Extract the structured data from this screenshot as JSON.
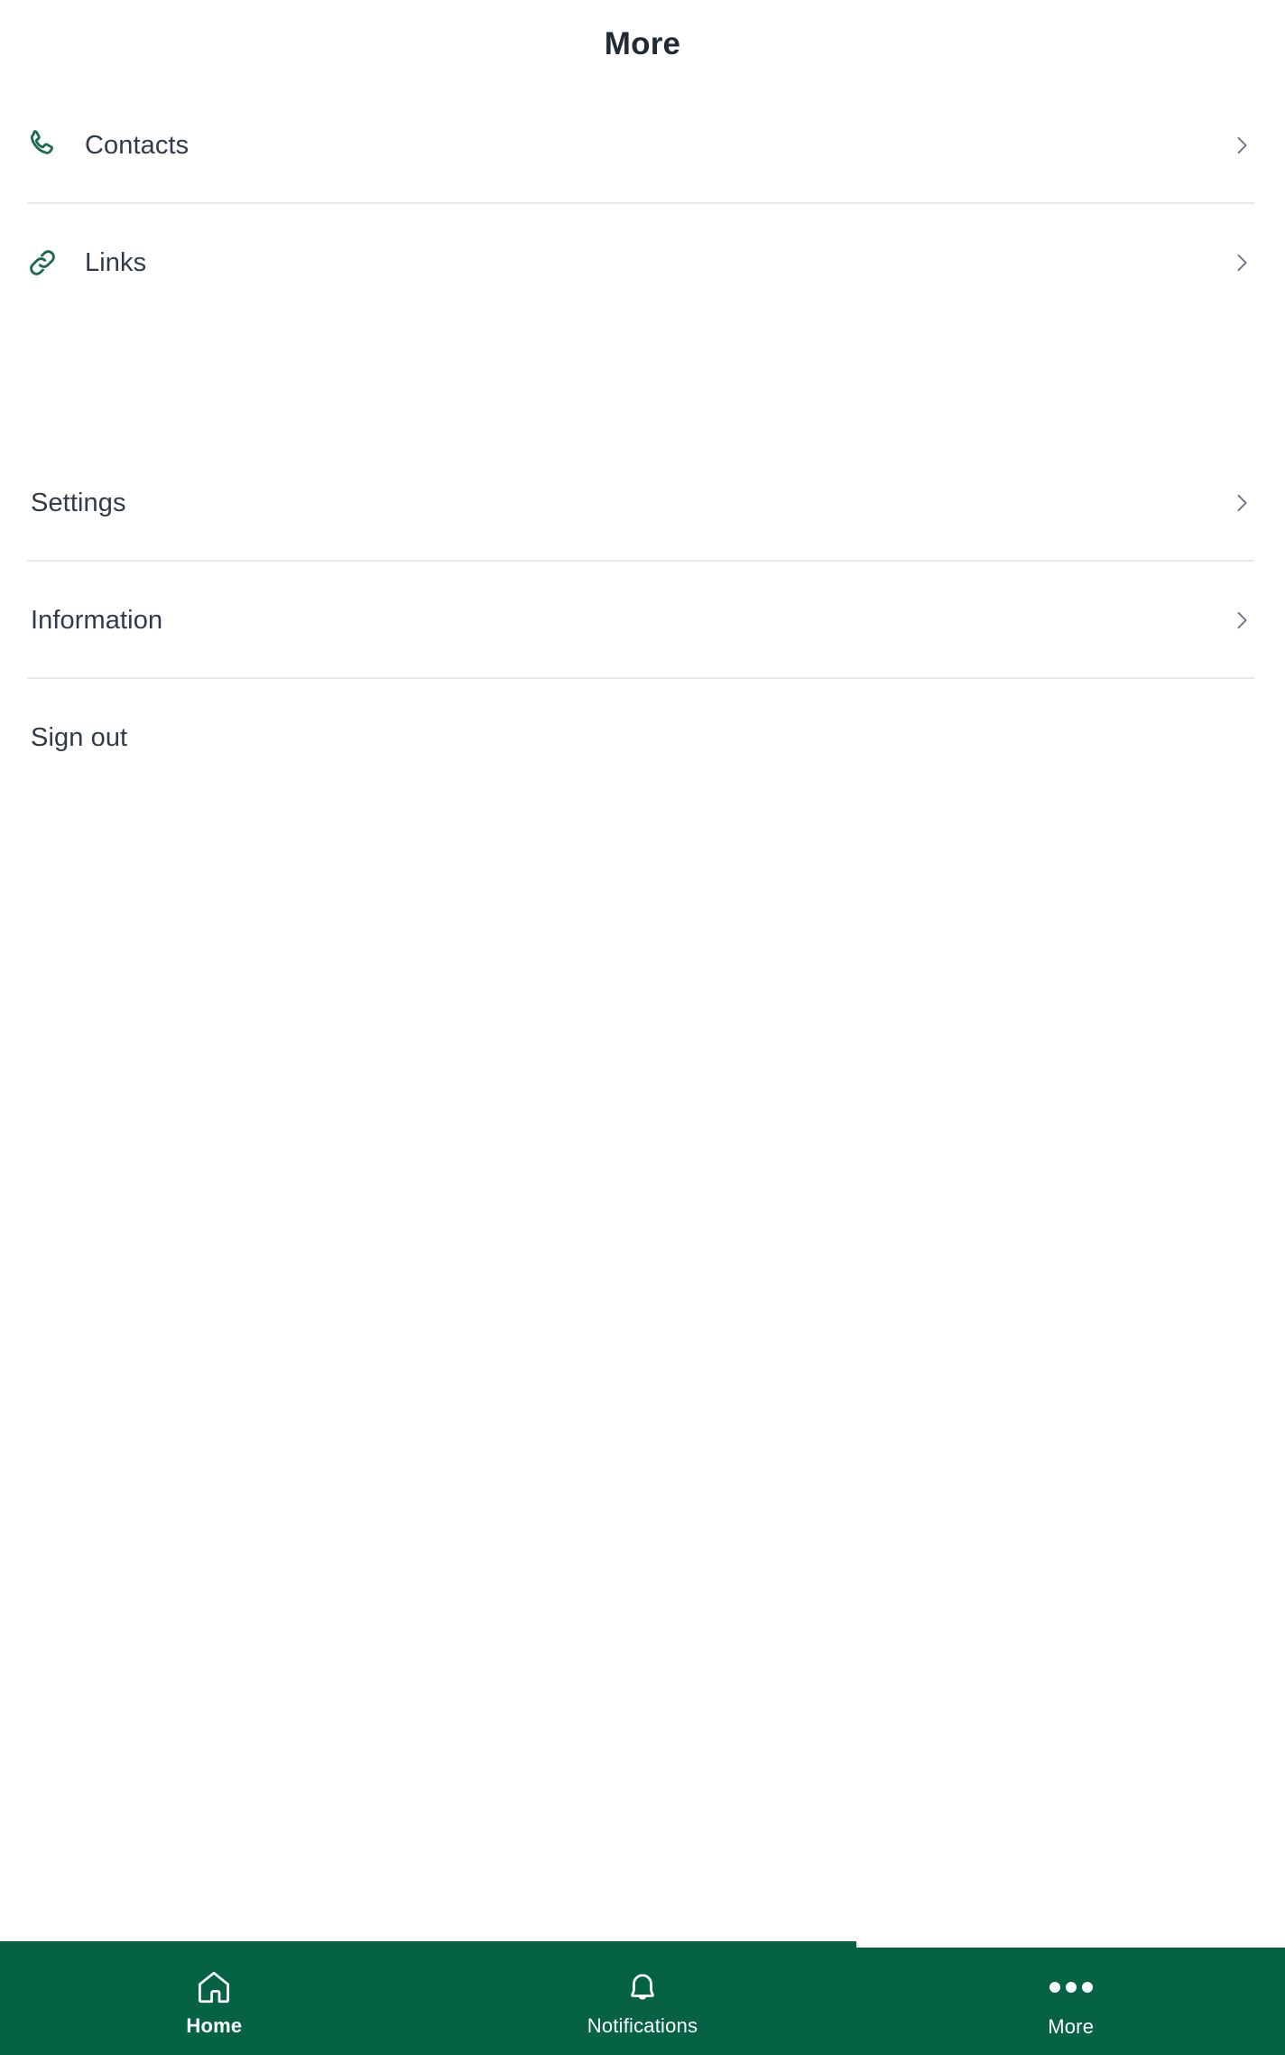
{
  "header": {
    "title": "More"
  },
  "colors": {
    "brand_green": "#056244",
    "icon_green": "#1c6b4d",
    "title_text": "#212b36",
    "row_text": "#313a46",
    "chevron": "#6b7280",
    "separator": "#e7e8ea",
    "background": "#ffffff"
  },
  "menu": {
    "group_one": [
      {
        "label": "Contacts",
        "icon": "phone-icon",
        "chevron": "chevron-right-icon",
        "has_separator": true
      },
      {
        "label": "Links",
        "icon": "link-icon",
        "chevron": "chevron-right-icon",
        "has_separator": false
      }
    ],
    "group_two": [
      {
        "label": "Settings",
        "icon": "",
        "chevron": "chevron-right-icon",
        "has_separator": true
      },
      {
        "label": "Information",
        "icon": "",
        "chevron": "chevron-right-icon",
        "has_separator": true
      },
      {
        "label": "Sign out",
        "icon": "",
        "chevron": "",
        "has_separator": false
      }
    ]
  },
  "bottom_nav": {
    "items": [
      {
        "label": "Home",
        "icon": "home-icon",
        "active": true
      },
      {
        "label": "Notifications",
        "icon": "bell-icon",
        "active": false
      },
      {
        "label": "More",
        "icon": "ellipsis-icon",
        "active": false
      }
    ]
  }
}
